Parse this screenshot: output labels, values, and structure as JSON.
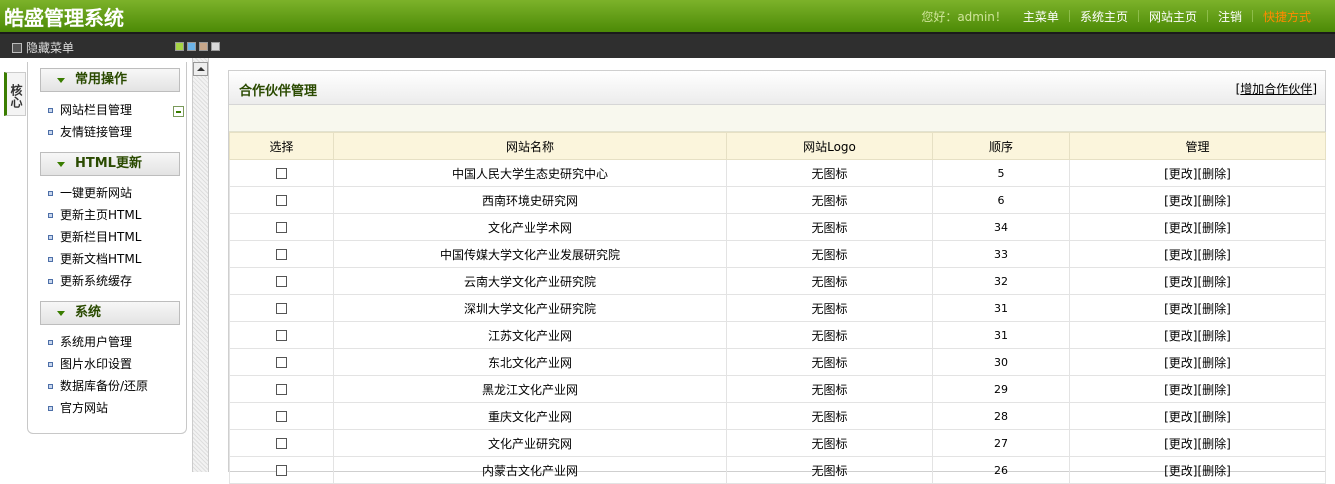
{
  "header": {
    "app_title": "皓盛管理系统",
    "greeting": "您好：admin！",
    "nav": [
      "主菜单",
      "系统主页",
      "网站主页",
      "注销"
    ],
    "quick_link": "快捷方式"
  },
  "subbar": {
    "hide_menu": "隐藏菜单",
    "skin_colors": [
      "#a6d445",
      "#6bb3e8",
      "#c8a78a",
      "#d8d8d8"
    ]
  },
  "side_tab": "核心",
  "menu": {
    "groups": [
      {
        "title": "常用操作",
        "items": [
          "网站栏目管理",
          "友情链接管理"
        ]
      },
      {
        "title": "HTML更新",
        "items": [
          "一键更新网站",
          "更新主页HTML",
          "更新栏目HTML",
          "更新文档HTML",
          "更新系统缓存"
        ]
      },
      {
        "title": "系统",
        "items": [
          "系统用户管理",
          "图片水印设置",
          "数据库备份/还原",
          "官方网站"
        ]
      }
    ]
  },
  "main": {
    "title": "合作伙伴管理",
    "add_link": "增加合作伙伴",
    "add_open": "[",
    "add_close": "]",
    "columns": [
      "选择",
      "网站名称",
      "网站Logo",
      "顺序",
      "管理"
    ],
    "edit_label": "[更改]",
    "delete_label": "[删除]",
    "rows": [
      {
        "name": "中国人民大学生态史研究中心",
        "logo": "无图标",
        "order": "5"
      },
      {
        "name": "西南环境史研究网",
        "logo": "无图标",
        "order": "6"
      },
      {
        "name": "文化产业学术网",
        "logo": "无图标",
        "order": "34"
      },
      {
        "name": "中国传媒大学文化产业发展研究院",
        "logo": "无图标",
        "order": "33"
      },
      {
        "name": "云南大学文化产业研究院",
        "logo": "无图标",
        "order": "32"
      },
      {
        "name": "深圳大学文化产业研究院",
        "logo": "无图标",
        "order": "31"
      },
      {
        "name": "江苏文化产业网",
        "logo": "无图标",
        "order": "31"
      },
      {
        "name": "东北文化产业网",
        "logo": "无图标",
        "order": "30"
      },
      {
        "name": "黑龙江文化产业网",
        "logo": "无图标",
        "order": "29"
      },
      {
        "name": "重庆文化产业网",
        "logo": "无图标",
        "order": "28"
      },
      {
        "name": "文化产业研究网",
        "logo": "无图标",
        "order": "27"
      },
      {
        "name": "内蒙古文化产业网",
        "logo": "无图标",
        "order": "26"
      }
    ]
  }
}
